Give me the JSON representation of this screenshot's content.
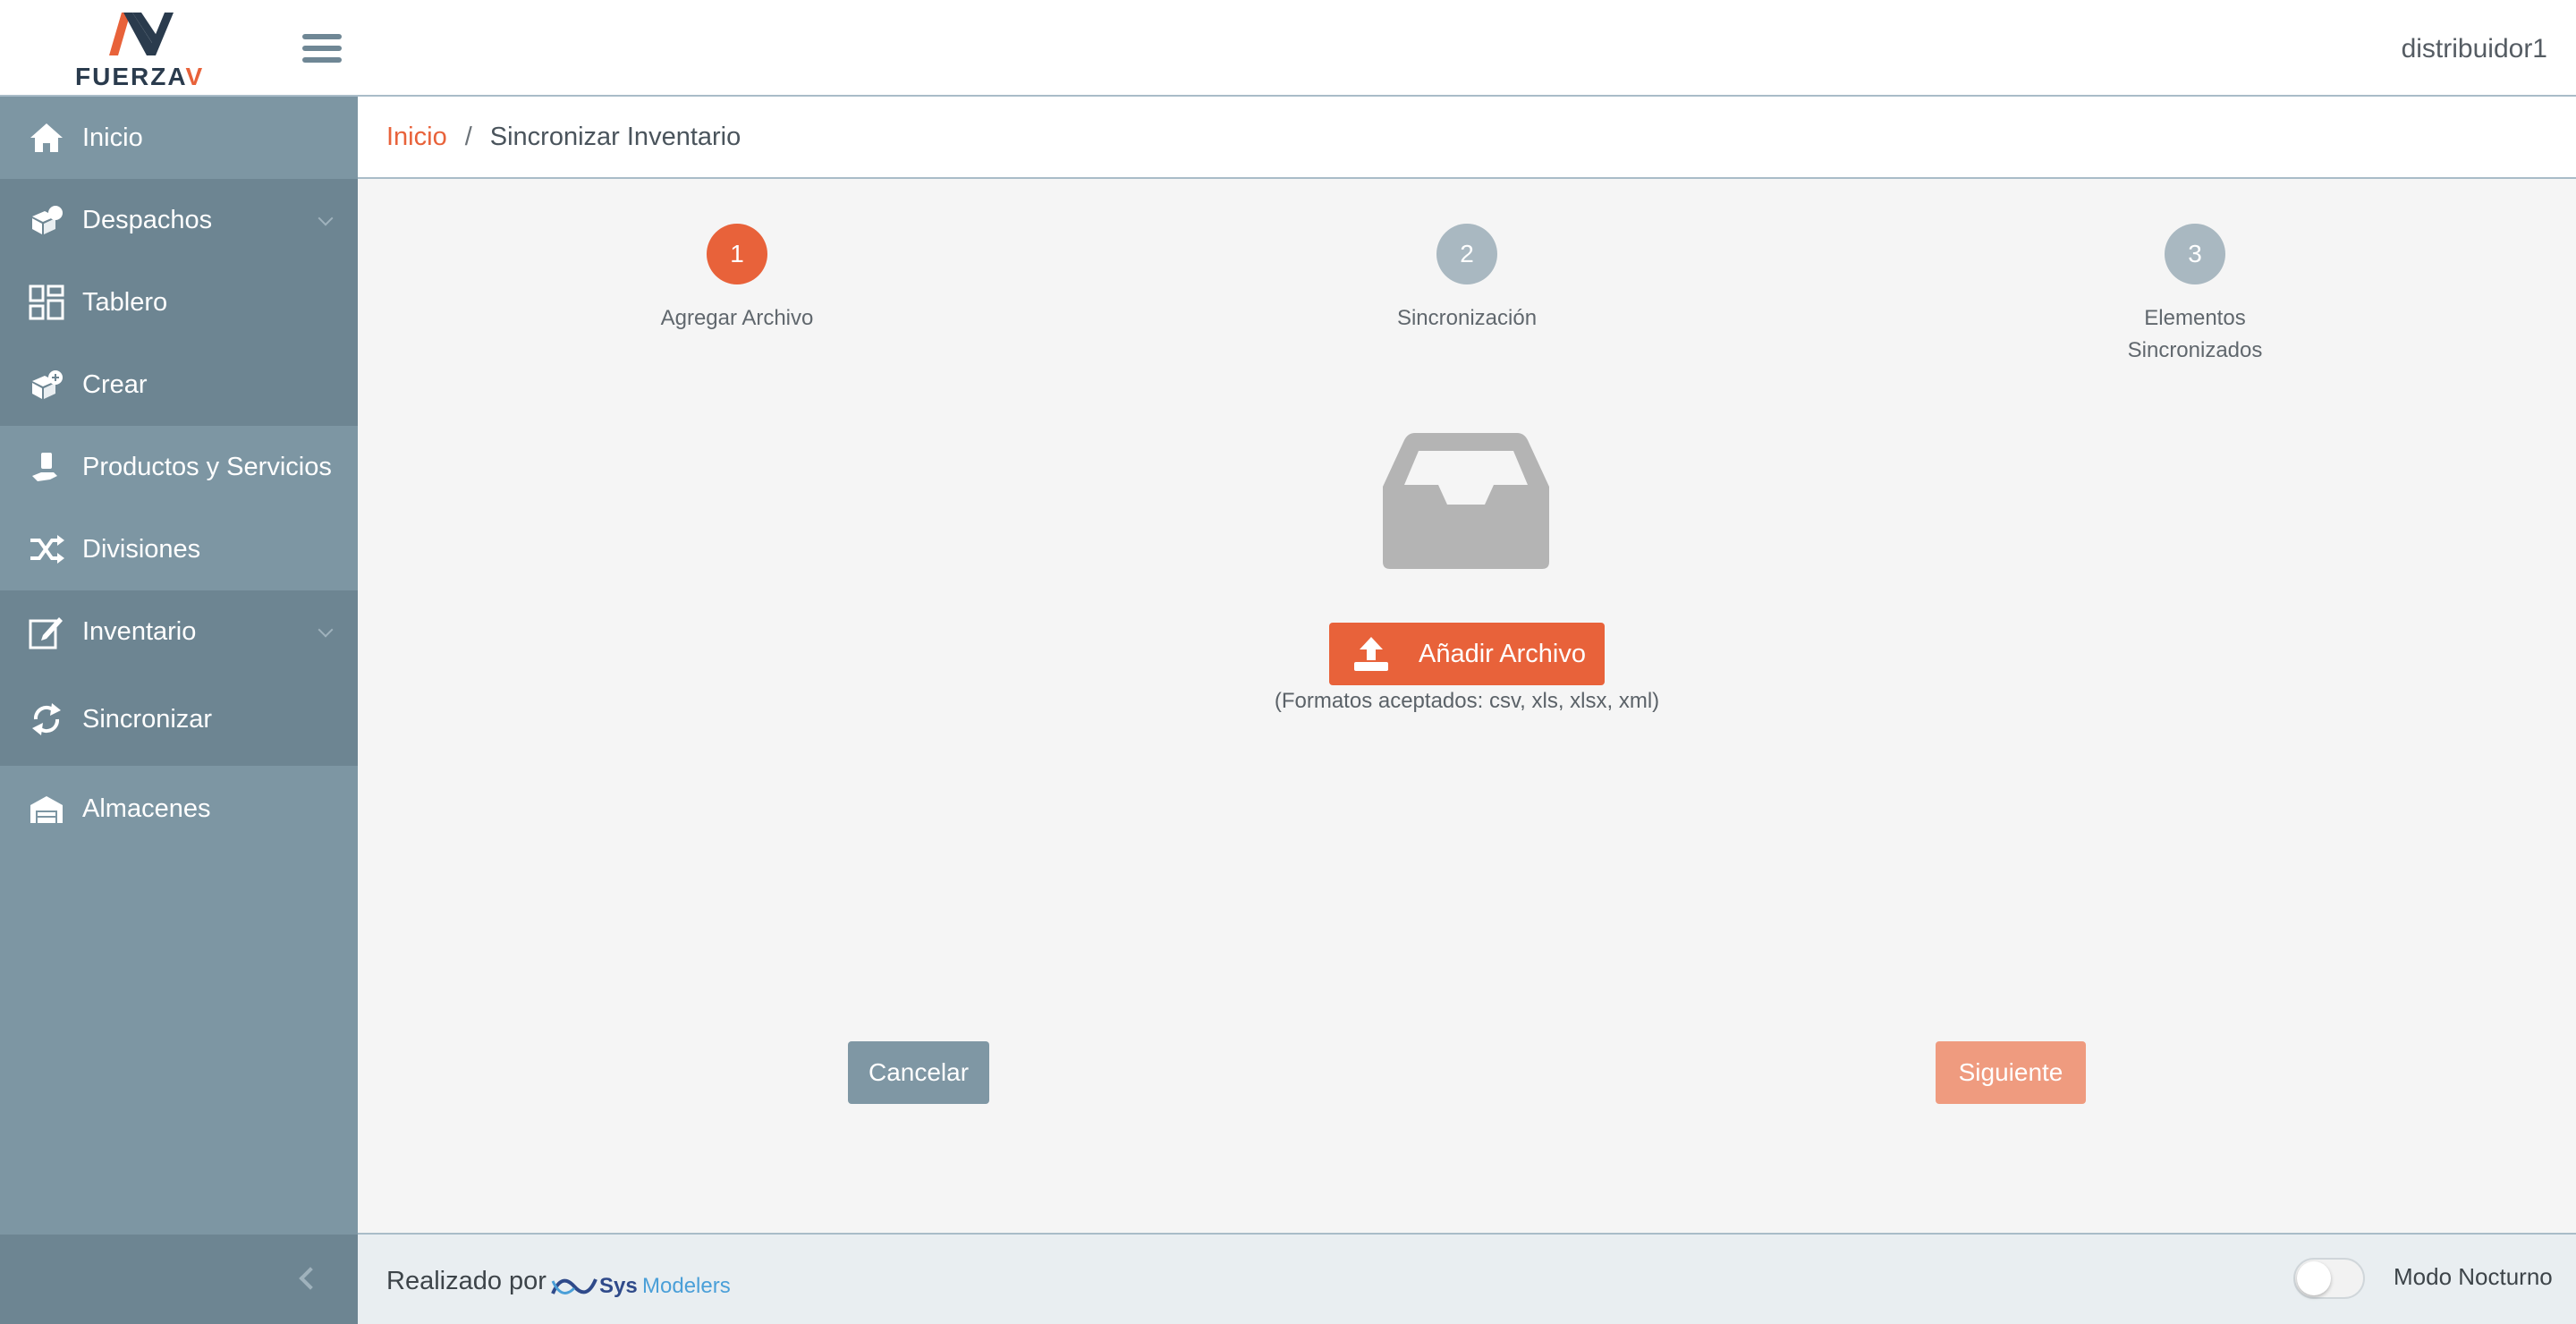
{
  "header": {
    "logo_text_main": "FUERZA",
    "logo_text_accent": "V",
    "user": "distribuidor1"
  },
  "sidebar": {
    "items": [
      {
        "label": "Inicio",
        "icon": "home-icon",
        "expandable": false
      },
      {
        "label": "Despachos",
        "icon": "boxes-icon",
        "expandable": true
      },
      {
        "label": "Tablero",
        "icon": "dashboard-icon",
        "expandable": false
      },
      {
        "label": "Crear",
        "icon": "box-plus-icon",
        "expandable": false
      },
      {
        "label": "Productos y Servicios",
        "icon": "hand-box-icon",
        "expandable": false
      },
      {
        "label": "Divisiones",
        "icon": "shuffle-icon",
        "expandable": false
      },
      {
        "label": "Inventario",
        "icon": "edit-icon",
        "expandable": true
      },
      {
        "label": "Sincronizar",
        "icon": "sync-icon",
        "expandable": false
      },
      {
        "label": "Almacenes",
        "icon": "warehouse-icon",
        "expandable": false
      }
    ]
  },
  "breadcrumb": {
    "home": "Inicio",
    "separator": "/",
    "current": "Sincronizar Inventario"
  },
  "stepper": {
    "steps": [
      {
        "number": "1",
        "label": "Agregar Archivo",
        "active": true
      },
      {
        "number": "2",
        "label": "Sincronización",
        "active": false
      },
      {
        "number": "3",
        "label_line1": "Elementos",
        "label_line2": "Sincronizados",
        "active": false
      }
    ]
  },
  "upload": {
    "button_label": "Añadir Archivo",
    "formats": "(Formatos aceptados: csv, xls, xlsx, xml)"
  },
  "actions": {
    "cancel": "Cancelar",
    "next": "Siguiente"
  },
  "footer": {
    "made_by": "Realizado por",
    "brand_a": "Sys",
    "brand_b": "Modelers",
    "night_mode": "Modo Nocturno",
    "night_mode_on": false
  },
  "colors": {
    "accent": "#e8623a",
    "sidebar": "#7d96a3",
    "sidebar_dark": "#6d8592",
    "step_inactive": "#a9b8c1"
  }
}
